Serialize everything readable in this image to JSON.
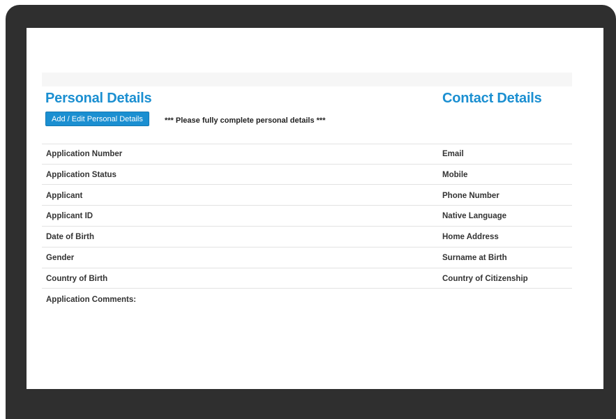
{
  "personal": {
    "title": "Personal Details",
    "edit_button": "Add / Edit Personal Details",
    "notice": "*** Please fully complete personal details ***",
    "fields": [
      "Application Number",
      "Application Status",
      "Applicant",
      "Applicant ID",
      "Date of Birth",
      "Gender",
      "Country of Birth"
    ],
    "comments_label": "Application Comments:"
  },
  "contact": {
    "title": "Contact Details",
    "fields": [
      "Email",
      "Mobile",
      "Phone Number",
      "Native Language",
      "Home Address",
      "Surname at Birth",
      "Country of Citizenship"
    ]
  },
  "colors": {
    "accent": "#1b8fd1",
    "bezel": "#2f2f2f"
  }
}
